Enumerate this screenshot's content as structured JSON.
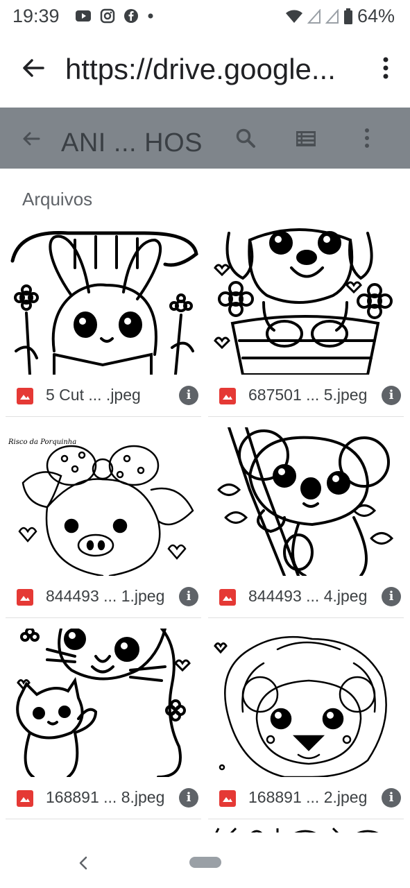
{
  "status_bar": {
    "time": "19:39",
    "battery": "64%",
    "icons": [
      "youtube-icon",
      "instagram-icon",
      "facebook-icon",
      "notification-dot-icon",
      "wifi-icon",
      "signal-icon",
      "signal-icon",
      "battery-icon"
    ]
  },
  "browser": {
    "url": "https://drive.google...",
    "back_icon": "arrow-back-icon",
    "menu_icon": "more-vert-icon"
  },
  "drive": {
    "folder_title": "ANI ... HOS",
    "icons": [
      "arrow-back-icon",
      "search-icon",
      "list-view-icon",
      "more-vert-icon"
    ],
    "section_label": "Arquivos",
    "files": [
      {
        "name": "5 Cut ... .jpeg",
        "thumb": "bunny-coloring-page"
      },
      {
        "name": "687501 ... 5.jpeg",
        "thumb": "puppy-coloring-page"
      },
      {
        "name": "844493 ... 1.jpeg",
        "thumb": "pig-coloring-page",
        "thumb_caption": "Risco da Porquinha"
      },
      {
        "name": "844493 ... 4.jpeg",
        "thumb": "koala-coloring-page"
      },
      {
        "name": "168891 ... 8.jpeg",
        "thumb": "cats-coloring-page"
      },
      {
        "name": "168891 ... 2.jpeg",
        "thumb": "lion-coloring-page"
      }
    ]
  },
  "colors": {
    "toolbar_bg": "#7f858b",
    "file_icon_red": "#e53935"
  }
}
